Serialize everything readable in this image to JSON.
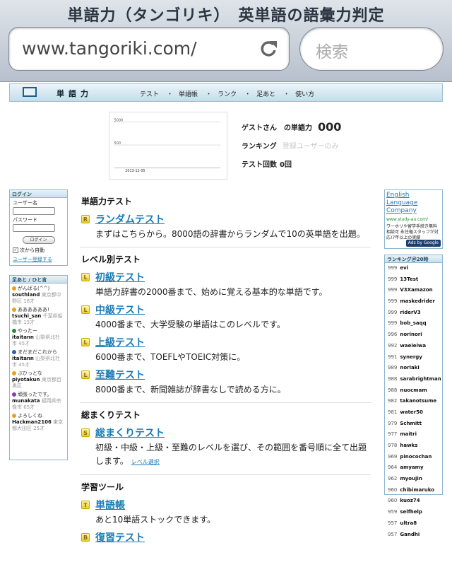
{
  "browser": {
    "title": "単語力（タンゴリキ）　英単語の語彙力判定",
    "url": "www.tangoriki.com/",
    "search_placeholder": "検索"
  },
  "site": {
    "logo": "単語力",
    "nav": [
      "テスト",
      "単語帳",
      "ランク",
      "足あと",
      "使い方"
    ]
  },
  "mini_chart": {
    "y_labels": [
      "5000",
      "500"
    ],
    "x_label": "2013-12-05"
  },
  "profile": {
    "user_label": "ゲストさん　の単語力",
    "score": "000",
    "ranking_label": "ランキング",
    "ranking_value": "登録ユーザーのみ",
    "tests_label": "テスト回数",
    "tests_value": "0回"
  },
  "login": {
    "header": "ログイン",
    "user_label": "ユーザー名",
    "password_label": "パスワード",
    "button": "ログイン",
    "auto_login": "次から自動",
    "register": "ユーザー登録する"
  },
  "footprints": {
    "header": "足あと / ひと言",
    "items": [
      {
        "msg": "がんばる(^^)",
        "user": "southland",
        "loc": "東京都中野区 18才",
        "color": "#e8a020"
      },
      {
        "msg": "ああああああ!",
        "user": "tsuchi_san",
        "loc": "千葉県船橋市 15才",
        "color": "#e8a020"
      },
      {
        "msg": "やったー",
        "user": "itaitann",
        "loc": "山梨県北杜市 45才",
        "color": "#2a8a3a"
      },
      {
        "msg": "まだまだこれから",
        "user": "itaitann",
        "loc": "山梨県北杜市 45才",
        "color": "#2a5fb0"
      },
      {
        "msg": "ぶひっとな",
        "user": "piyotakun",
        "loc": "東京都目黒区",
        "color": "#e8a020"
      },
      {
        "msg": "頑張ったです。",
        "user": "munakata",
        "loc": "福岡県宗像市 65才",
        "color": "#8a3ab0"
      },
      {
        "msg": "よろしくね",
        "user": "Hackman2106",
        "loc": "東京都大田区 25才",
        "color": "#e8a020"
      }
    ]
  },
  "main": {
    "sections": [
      {
        "title": "単語力テスト",
        "items": [
          {
            "badge": "R",
            "link": "ランダムテスト",
            "desc": "まずはこちらから。8000語の辞書からランダムで10の英単語を出題。"
          }
        ]
      },
      {
        "title": "レベル別テスト",
        "items": [
          {
            "badge": "L",
            "link": "初級テスト",
            "desc": "単語力辞書の2000番まで、始めに覚える基本的な単語です。"
          },
          {
            "badge": "L",
            "link": "中級テスト",
            "desc": "4000番まで、大学受験の単語はこのレベルです。"
          },
          {
            "badge": "L",
            "link": "上級テスト",
            "desc": "6000番まで、TOEFLやTOEIC対策に。"
          },
          {
            "badge": "L",
            "link": "至難テスト",
            "desc": "8000番まで、新聞雑誌が辞書なしで読める方に。"
          }
        ]
      },
      {
        "title": "総まくりテスト",
        "items": [
          {
            "badge": "S",
            "link": "総まくりテスト",
            "desc": "初級・中級・上級・至難のレベルを選び、その範囲を番号順に全て出題します。",
            "extra": "レベル選択"
          }
        ]
      },
      {
        "title": "学習ツール",
        "items": [
          {
            "badge": "T",
            "link": "単語帳",
            "desc": "あと10単語ストックできます。"
          },
          {
            "badge": "B",
            "link": "復習テスト",
            "desc": ""
          }
        ]
      }
    ]
  },
  "ad": {
    "title": "English Language Company",
    "url": "www.study-au.com/",
    "text": "ワーホリや留学手続き無料相談可 永住権スタッフが対応!7年以上の実績",
    "ads_by": "Ads by Google"
  },
  "ranking": {
    "header": "ランキング＠20時",
    "rows": [
      {
        "score": "999",
        "name": "evi"
      },
      {
        "score": "999",
        "name": "13Test"
      },
      {
        "score": "999",
        "name": "V3Xamazon"
      },
      {
        "score": "999",
        "name": "maskedrider"
      },
      {
        "score": "999",
        "name": "riderV3"
      },
      {
        "score": "999",
        "name": "bob_saqq"
      },
      {
        "score": "996",
        "name": "norinori"
      },
      {
        "score": "992",
        "name": "waeieiwa"
      },
      {
        "score": "991",
        "name": "synergy"
      },
      {
        "score": "989",
        "name": "noriaki"
      },
      {
        "score": "988",
        "name": "sarabrightman"
      },
      {
        "score": "988",
        "name": "nuocmam"
      },
      {
        "score": "982",
        "name": "takanotsume"
      },
      {
        "score": "981",
        "name": "water50"
      },
      {
        "score": "979",
        "name": "Schmitt"
      },
      {
        "score": "977",
        "name": "maitri"
      },
      {
        "score": "978",
        "name": "hawks"
      },
      {
        "score": "969",
        "name": "pinocochan"
      },
      {
        "score": "964",
        "name": "amyamy"
      },
      {
        "score": "962",
        "name": "myoujin"
      },
      {
        "score": "960",
        "name": "chibimaruko"
      },
      {
        "score": "960",
        "name": "kuoz74"
      },
      {
        "score": "959",
        "name": "selfhelp"
      },
      {
        "score": "957",
        "name": "ultra8"
      },
      {
        "score": "957",
        "name": "Gandhi"
      }
    ]
  }
}
